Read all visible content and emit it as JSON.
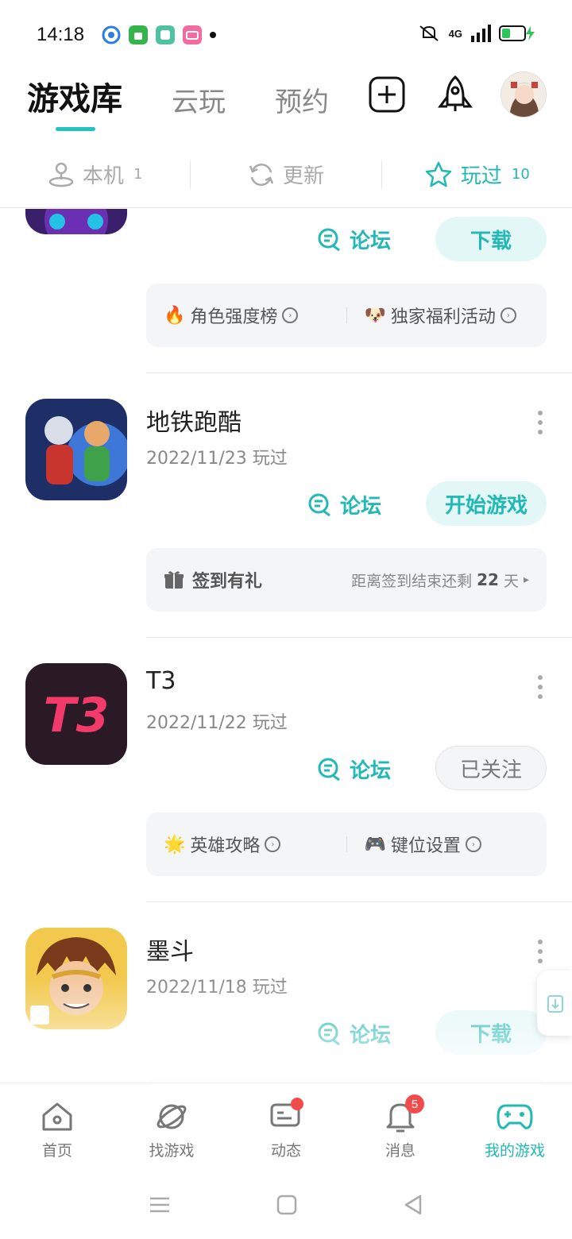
{
  "status_bar": {
    "time": "14:18",
    "network": "4G",
    "app_icons": [
      "circle-app-icon",
      "android-app-icon",
      "square-app-icon",
      "bilibili-app-icon"
    ]
  },
  "header": {
    "tabs": [
      {
        "label": "游戏库",
        "active": true
      },
      {
        "label": "云玩",
        "active": false
      },
      {
        "label": "预约",
        "active": false
      }
    ],
    "actions": [
      "add-icon",
      "rocket-icon",
      "avatar"
    ]
  },
  "sub_tabs": [
    {
      "label": "本机",
      "count": "1",
      "icon": "joystick-icon",
      "active": false
    },
    {
      "label": "更新",
      "count": "",
      "icon": "refresh-icon",
      "active": false
    },
    {
      "label": "玩过",
      "count": "10",
      "icon": "star-icon",
      "active": true
    }
  ],
  "games": [
    {
      "title": "",
      "date": "",
      "forum": "论坛",
      "action": "下载",
      "extras": [
        {
          "icon": "🔥",
          "label": "角色强度榜"
        },
        {
          "icon": "🐶",
          "label": "独家福利活动"
        }
      ]
    },
    {
      "title": "地铁跑酷",
      "date": "2022/11/23 玩过",
      "forum": "论坛",
      "action": "开始游戏",
      "checkin": {
        "label": "签到有礼",
        "prefix": "距离签到结束还剩",
        "days": "22",
        "suffix": "天"
      }
    },
    {
      "title": "T3",
      "date": "2022/11/22 玩过",
      "forum": "论坛",
      "action": "已关注",
      "icon_text": "T3",
      "extras": [
        {
          "icon": "🌟",
          "label": "英雄攻略"
        },
        {
          "icon": "🎮",
          "label": "键位设置"
        }
      ]
    },
    {
      "title": "墨斗",
      "date": "2022/11/18 玩过",
      "forum": "论坛",
      "action": "下载"
    }
  ],
  "bottom_nav": [
    {
      "label": "首页",
      "icon": "home-icon",
      "active": false
    },
    {
      "label": "找游戏",
      "icon": "planet-icon",
      "active": false
    },
    {
      "label": "动态",
      "icon": "chat-icon",
      "active": false,
      "dot": true
    },
    {
      "label": "消息",
      "icon": "bell-icon",
      "active": false,
      "badge": "5"
    },
    {
      "label": "我的游戏",
      "icon": "gamepad-icon",
      "active": true
    }
  ],
  "colors": {
    "accent": "#21b8b6",
    "badge": "#f24b4b"
  }
}
